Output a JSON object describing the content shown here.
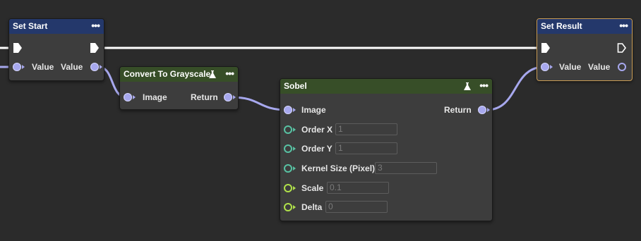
{
  "nodes": {
    "set_start": {
      "title": "Set Start",
      "menu": "•••",
      "input_label": "Value",
      "output_label": "Value"
    },
    "grayscale": {
      "title": "Convert To Grayscale",
      "menu": "•••",
      "input_label": "Image",
      "output_label": "Return"
    },
    "sobel": {
      "title": "Sobel",
      "menu": "•••",
      "input_label": "Image",
      "output_label": "Return",
      "params": [
        {
          "label": "Order X",
          "value": "1"
        },
        {
          "label": "Order Y",
          "value": "1"
        },
        {
          "label": "Kernel Size (Pixel)",
          "value": "3"
        },
        {
          "label": "Scale",
          "value": "0.1"
        },
        {
          "label": "Delta",
          "value": "0"
        }
      ]
    },
    "set_result": {
      "title": "Set Result",
      "menu": "•••",
      "input_label": "Value",
      "output_label": "Value"
    }
  },
  "colors": {
    "canvas": "#2b2b2b",
    "node_body": "#3d3d3d",
    "header_blue": "#24386b",
    "header_green": "#374e28",
    "value_wire": "#a7a8ee",
    "exec_wire": "#ffffff",
    "int_pin": "#58c2a3",
    "float_pin": "#b0e14a",
    "selected_border": "#c99c55"
  },
  "icons": [
    "flask-icon",
    "more-dots-icon",
    "exec-pin-icon",
    "data-pin-icon"
  ]
}
